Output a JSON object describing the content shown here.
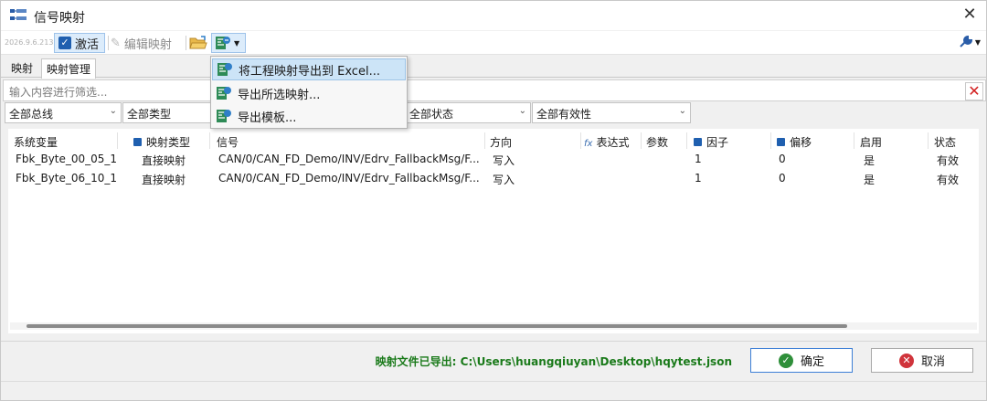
{
  "window": {
    "title": "信号映射",
    "close_glyph": "✕"
  },
  "toolbar": {
    "version": "2026.9.6.2137",
    "activate_label": "激活",
    "edit_label": "编辑映射",
    "export_dropdown_caret": "▼",
    "tools_caret": "▼"
  },
  "tabs": [
    "映射",
    "映射管理"
  ],
  "filter": {
    "placeholder": "输入内容进行筛选..."
  },
  "selects": [
    {
      "value": "全部总线"
    },
    {
      "value": "全部类型"
    },
    {
      "value": "全部状态"
    },
    {
      "value": "全部有效性"
    }
  ],
  "table": {
    "headers": [
      "系统变量",
      "映射类型",
      "信号",
      "方向",
      "表达式",
      "参数",
      "因子",
      "偏移",
      "启用",
      "状态"
    ],
    "rows": [
      [
        "Fbk_Byte_00_05_1",
        "直接映射",
        "CAN/0/CAN_FD_Demo/INV/Edrv_FallbackMsg/F...",
        "写入",
        "",
        "",
        "1",
        "0",
        "是",
        "有效"
      ],
      [
        "Fbk_Byte_06_10_1",
        "直接映射",
        "CAN/0/CAN_FD_Demo/INV/Edrv_FallbackMsg/F...",
        "写入",
        "",
        "",
        "1",
        "0",
        "是",
        "有效"
      ]
    ]
  },
  "export_menu": {
    "items": [
      "将工程映射导出到 Excel...",
      "导出所选映射...",
      "导出模板..."
    ],
    "highlighted_index": 0
  },
  "footer": {
    "status": "映射文件已导出: C:\\Users\\huangqiuyan\\Desktop\\hqytest.json",
    "ok_label": "确定",
    "cancel_label": "取消"
  },
  "colors": {
    "accent": "#1f5faf",
    "success": "#1a7a1a",
    "danger": "#d21f1f",
    "highlight": "#cce4f7"
  },
  "icons": [
    "mapping-app-icon",
    "close-icon",
    "checkbox-icon",
    "pencil-icon",
    "folder-open-icon",
    "export-excel-icon",
    "wrench-icon",
    "clear-filter-icon",
    "chevron-down-icon",
    "function-icon",
    "check-circle-icon",
    "cancel-circle-icon"
  ]
}
